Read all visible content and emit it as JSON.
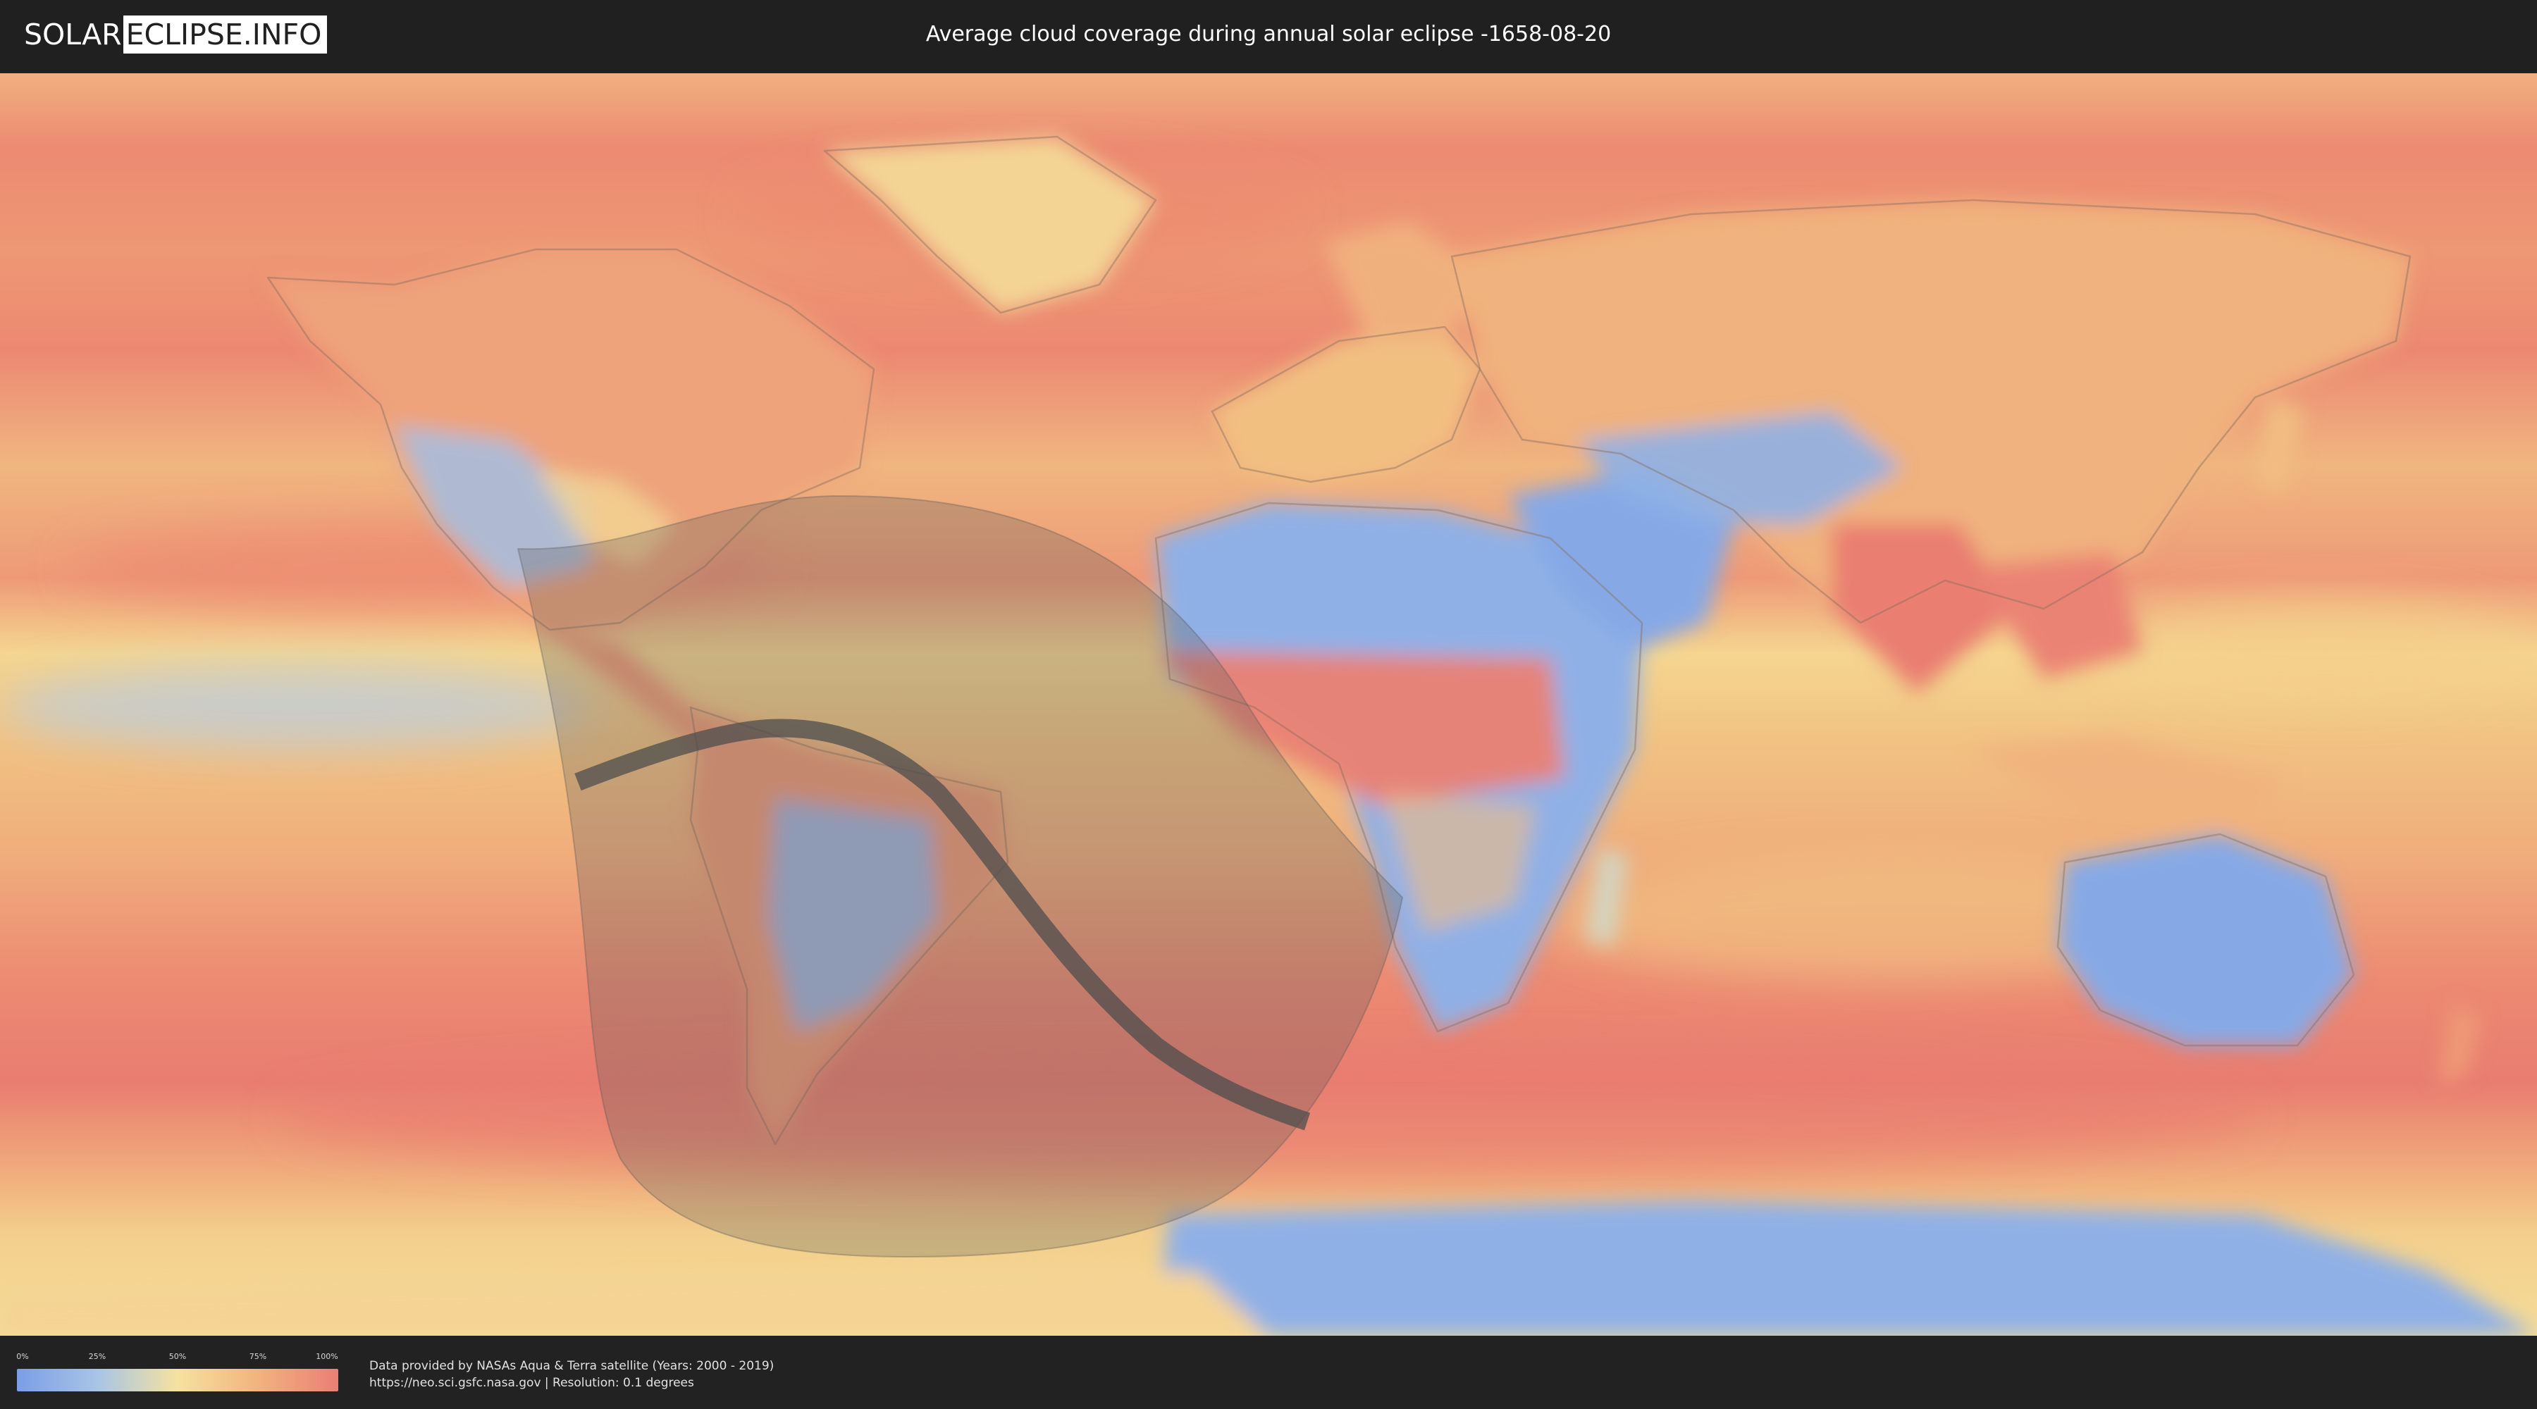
{
  "header": {
    "logo": {
      "part1": "SOLAR",
      "part2": "ECLIPSE.INFO"
    },
    "title": "Average cloud coverage during annual solar eclipse -1658-08-20"
  },
  "map": {
    "data_layer": "average cloud coverage",
    "colors": {
      "ocean_cloudy": "#ec8a72",
      "ocean_mid": "#f1c482",
      "land_clear": "#7ea2e4",
      "coast_outline": "#8a6f5f",
      "eclipse_shadow": "#5a5a5a"
    }
  },
  "legend": {
    "tick_labels": [
      "0%",
      "25%",
      "50%",
      "75%",
      "100%"
    ],
    "gradient_colors": [
      "#7a9ee6",
      "#a8c4e6",
      "#f5e2a0",
      "#f2b37e",
      "#ea7f76"
    ]
  },
  "credits": {
    "line1": "Data provided by NASAs Aqua & Terra satellite (Years: 2000 - 2019)",
    "line2": "https://neo.sci.gsfc.nasa.gov | Resolution: 0.1 degrees"
  }
}
